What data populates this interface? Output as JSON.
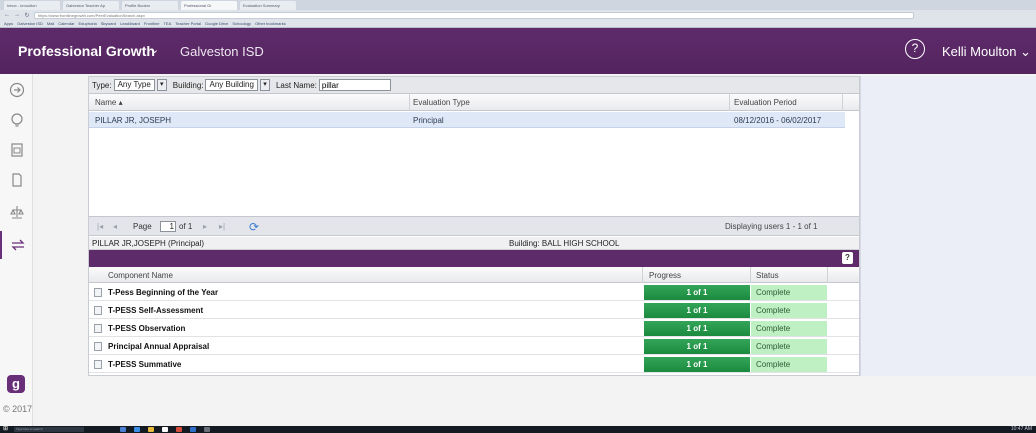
{
  "browser": {
    "tabs": [
      "Inbox - kmoulton",
      "Galveston Teacher Ap",
      "Profile Bookm",
      "Professional Gr",
      "Evaluation Summary"
    ],
    "url": "https://www.frontlinegrowth.com/PeerEvaluationSearch.aspx",
    "bookmarks": [
      "Apps",
      "Galveston ISD",
      "Mail",
      "Calendar",
      "Eduphoria",
      "Skyward",
      "Lead4ward",
      "Frontline",
      "TEA",
      "Teacher Portal",
      "Google Drive",
      "Schoology",
      "Other bookmarks"
    ]
  },
  "header": {
    "app_title": "Professional Growth",
    "caret": "⌄",
    "district": "Galveston ISD",
    "help_glyph": "?",
    "user": "Kelli Moulton ⌄"
  },
  "sidebar": {
    "icons": [
      "arrow-circle-icon",
      "lightbulb-icon",
      "clipboard-icon",
      "document-icon",
      "scale-icon",
      "swap-arrows-icon"
    ],
    "active_index": 5,
    "logo_glyph": "g",
    "copyright": "© 2017"
  },
  "filters": {
    "type_label": "Type:",
    "type_value": "Any Type",
    "building_label": "Building:",
    "building_value": "Any Building",
    "lastname_label": "Last Name:",
    "lastname_value": "pillar",
    "dropdown_glyph": "▾"
  },
  "grid": {
    "columns": [
      "Name ▴",
      "Evaluation Type",
      "Evaluation Period"
    ],
    "rows": [
      {
        "name": "PILLAR JR, JOSEPH",
        "type": "Principal",
        "period": "08/12/2016 - 06/02/2017"
      }
    ]
  },
  "pager": {
    "first": "|◂",
    "prev": "◂",
    "page_label": "Page",
    "page_value": "1",
    "of_label": "of 1",
    "next": "▸",
    "last": "▸|",
    "refresh": "⟳",
    "display_text": "Displaying users 1 - 1 of 1"
  },
  "selection": {
    "person": "PILLAR JR,JOSEPH (Principal)",
    "building": "Building: BALL HIGH SCHOOL",
    "help_glyph": "?"
  },
  "components": {
    "columns": [
      "Component Name",
      "Progress",
      "Status"
    ],
    "rows": [
      {
        "name": "T-Pess Beginning of the Year",
        "progress": "1 of 1",
        "progress_fraction": 1.0,
        "status": "Complete"
      },
      {
        "name": "T-PESS Self-Assessment",
        "progress": "1 of 1",
        "progress_fraction": 1.0,
        "status": "Complete"
      },
      {
        "name": "T-PESS Observation",
        "progress": "1 of 1",
        "progress_fraction": 1.0,
        "status": "Complete"
      },
      {
        "name": "Principal Annual Appraisal",
        "progress": "1 of 1",
        "progress_fraction": 1.0,
        "status": "Complete"
      },
      {
        "name": "T-PESS Summative",
        "progress": "1 of 1",
        "progress_fraction": 1.0,
        "status": "Complete"
      }
    ]
  },
  "taskbar": {
    "start_glyph": "⊞",
    "search_placeholder": "Type here to search",
    "clock": "10:47 AM"
  },
  "colors": {
    "brand_purple": "#5e2b6a",
    "progress_green": "#1b8a3f",
    "status_green": "#bff0c4",
    "selected_row": "#dfe8f6"
  }
}
